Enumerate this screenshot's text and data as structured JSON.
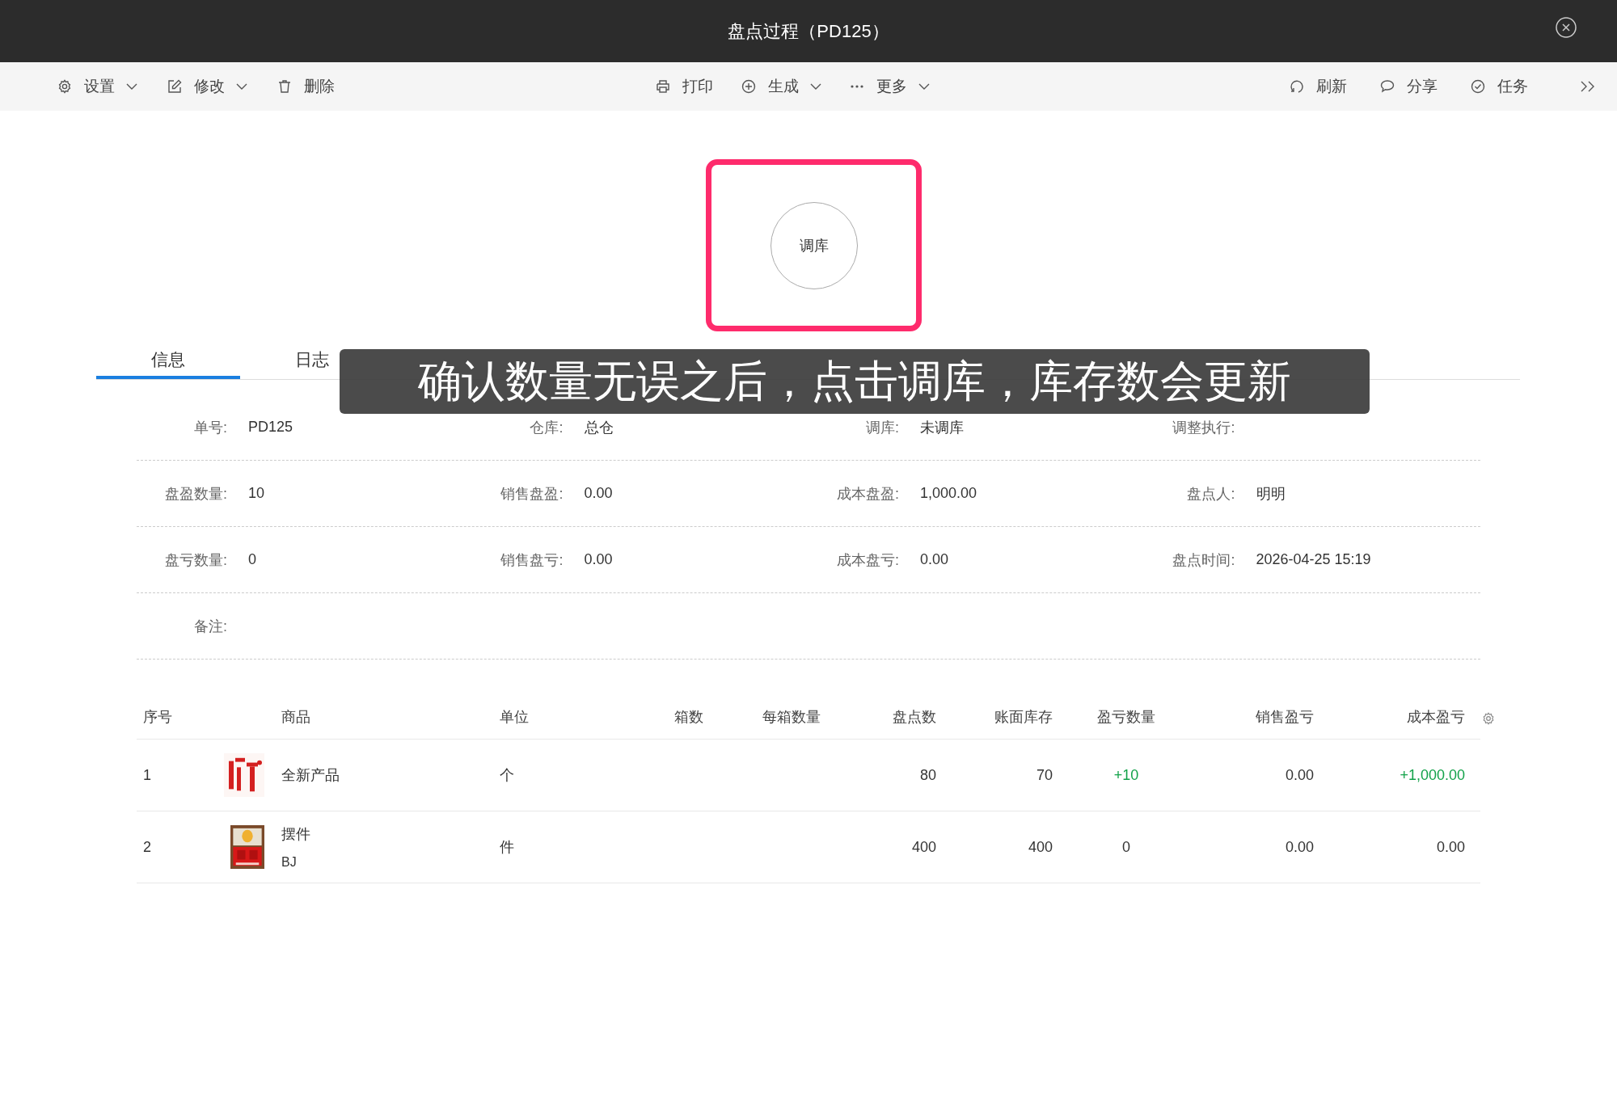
{
  "window": {
    "title": "盘点过程（PD125）"
  },
  "toolbar": {
    "left": [
      {
        "label": "设置",
        "dropdown": true
      },
      {
        "label": "修改",
        "dropdown": true
      },
      {
        "label": "删除",
        "dropdown": false
      }
    ],
    "center": [
      {
        "label": "打印",
        "dropdown": false
      },
      {
        "label": "生成",
        "dropdown": true
      },
      {
        "label": "更多",
        "dropdown": true
      }
    ],
    "right": [
      {
        "label": "刷新",
        "dropdown": false
      },
      {
        "label": "分享",
        "dropdown": false
      },
      {
        "label": "任务",
        "dropdown": false
      }
    ]
  },
  "action_button": {
    "label": "调库"
  },
  "tabs": [
    {
      "label": "信息",
      "selected": true
    },
    {
      "label": "日志",
      "selected": false
    }
  ],
  "caption": "确认数量无误之后，点击调库，库存数会更新",
  "info_rows": [
    [
      {
        "label": "单号:",
        "value": "PD125"
      },
      {
        "label": "仓库:",
        "value": "总仓"
      },
      {
        "label": "调库:",
        "value": "未调库"
      },
      {
        "label": "调整执行:"
      }
    ],
    [
      {
        "label": "盘盈数量:",
        "value": "10"
      },
      {
        "label": "销售盘盈:",
        "value": "0.00"
      },
      {
        "label": "成本盘盈:",
        "value": "1,000.00"
      },
      {
        "label": "盘点人:",
        "value": "明明"
      }
    ],
    [
      {
        "label": "盘亏数量:",
        "value": "0"
      },
      {
        "label": "销售盘亏:",
        "value": "0.00"
      },
      {
        "label": "成本盘亏:",
        "value": "0.00"
      },
      {
        "label": "盘点时间:",
        "value": "2026-04-25 15:19"
      }
    ],
    [
      {
        "label": "备注:"
      }
    ]
  ],
  "table": {
    "columns": [
      "序号",
      "商品",
      "单位",
      "箱数",
      "每箱数量",
      "盘点数",
      "账面库存",
      "盈亏数量",
      "销售盈亏",
      "成本盈亏"
    ],
    "rows": [
      {
        "index": "1",
        "name": "全新产品",
        "unit": "个",
        "counted": "80",
        "book": "70",
        "diff": "+10",
        "sales_diff": "0.00",
        "cost_diff": "+1,000.00",
        "gain": true
      },
      {
        "index": "2",
        "name": "摆件",
        "code": "BJ",
        "unit": "件",
        "counted": "400",
        "book": "400",
        "diff": "0",
        "sales_diff": "0.00",
        "cost_diff": "0.00",
        "gain": false
      }
    ]
  }
}
